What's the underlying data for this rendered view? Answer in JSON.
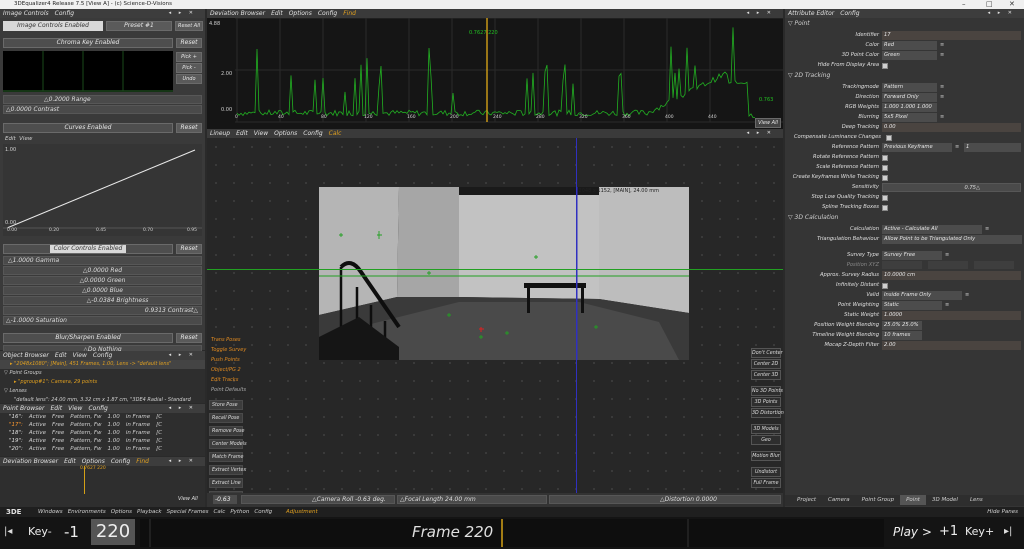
{
  "window": {
    "title": "3DEqualizer4 Release 7.5  [View A] - (c) Science-D-Visions",
    "min": "–",
    "max": "□",
    "close": "✕"
  },
  "image_controls": {
    "title": "Image Controls",
    "config": "Config",
    "enabled_label": "Image Controls Enabled",
    "preset": "Preset #1",
    "reset_all": "Reset All",
    "chroma": {
      "label": "Chroma Key Enabled",
      "reset": "Reset",
      "pick_plus": "Pick +",
      "pick_minus": "Pick -",
      "undo": "Undo",
      "range": "0.2000 Range",
      "contrast": "0.0000 Contrast"
    },
    "curves": {
      "label": "Curves Enabled",
      "reset": "Reset",
      "edit": "Edit",
      "view": "View",
      "y_top": "1.00",
      "y_bottom": "0.00",
      "x_ticks": [
        "0.00",
        "0.20",
        "0.45",
        "0.70",
        "0.95"
      ]
    },
    "color": {
      "label": "Color Controls Enabled",
      "reset": "Reset",
      "gamma": "1.0000 Gamma",
      "red": "0.0000 Red",
      "green": "0.0000 Green",
      "blue": "0.0000 Blue",
      "brightness": "-0.0384 Brightness",
      "contrast": "0.9313 Contrast",
      "saturation": "-1.0000 Saturation"
    },
    "blur": {
      "label": "Blur/Sharpen Enabled",
      "reset": "Reset",
      "value": "Do Nothing"
    }
  },
  "object_browser": {
    "title": "Object Browser",
    "menus": [
      "Edit",
      "View",
      "Config"
    ],
    "camera_line": "\"2048x1080\"; [Main], 451 Frames, 1.00, Lens -> \"default lens\"",
    "point_groups": "Point Groups",
    "pgroup_line": "\"pgroup#1\": Camera, 29 points",
    "lenses": "Lenses",
    "lens_line": "\"default lens\": 24.00 mm, 3.32 cm x 1.87 cm, \"3DE4 Radial - Standard"
  },
  "point_browser": {
    "title": "Point Browser",
    "menus": [
      "Edit",
      "View",
      "Config"
    ],
    "rows": [
      [
        "\"16\":",
        "Active",
        "Free",
        "Pattern, Fw",
        "1.00",
        "in Frame",
        "[C"
      ],
      [
        "\"17\":",
        "Active",
        "Free",
        "Pattern, Fw",
        "1.00",
        "in Frame",
        "[C"
      ],
      [
        "\"18\":",
        "Active",
        "Free",
        "Pattern, Fw",
        "1.00",
        "in Frame",
        "[C"
      ],
      [
        "\"19\":",
        "Active",
        "Free",
        "Pattern, Fw",
        "1.00",
        "in Frame",
        "[C"
      ],
      [
        "\"20\":",
        "Active",
        "Free",
        "Pattern, Fw",
        "1.00",
        "in Frame",
        "[C"
      ]
    ]
  },
  "deviation_small": {
    "title": "Deviation Browser",
    "menus": [
      "Edit",
      "Options",
      "Config"
    ],
    "find": "Find",
    "readout": "0.7627 220",
    "view_all": "View All"
  },
  "deviation_browser": {
    "title": "Deviation Browser",
    "menus": [
      "Edit",
      "Options",
      "Config"
    ],
    "find": "Find",
    "y_labels": [
      "4.88",
      "2.00",
      "0.00"
    ],
    "x_labels": [
      "0",
      "40",
      "80",
      "120",
      "160",
      "200",
      "240",
      "280",
      "320",
      "360",
      "400",
      "440"
    ],
    "marker_readout": "0.7627 220",
    "end_readout": "0.763",
    "view_all": "View All"
  },
  "viewport": {
    "menus": [
      "Lineup",
      "Edit",
      "View",
      "Options",
      "Config"
    ],
    "calc": "Calc",
    "image_info": "2048 x 1152, [MAIN], 24.00 mm",
    "left_orange": [
      "Trans Poses",
      "Toggle Survey",
      "Push Points",
      "Object/PG 2",
      "Edit Tracks"
    ],
    "left_gray": [
      "Point Defaults"
    ],
    "left_buttons": [
      "Store Pose",
      "Recall Pose",
      "Remove Pose",
      "Center Models",
      "Match Frame",
      "Extract Vertex",
      "Extract Line",
      "Extract Polygon"
    ],
    "right_buttons": [
      "Don't Center",
      "Center 2D",
      "Center 3D",
      "No 3D Points",
      "3D Points",
      "3D Distortion",
      "3D Models",
      "Geo",
      "Motion Blur",
      "Undistort",
      "Full Frame"
    ],
    "bottom": {
      "value": "-0.63",
      "roll": "Camera Roll -0.63 deg.",
      "focal": "Focal Length 24.00 mm",
      "distortion": "Distortion 0.0000"
    }
  },
  "attribute_editor": {
    "title": "Attribute Editor",
    "config": "Config",
    "point_section": "Point",
    "identifier_label": "Identifier",
    "identifier": "17",
    "color_label": "Color",
    "color": "Red",
    "color3d_label": "3D Point Color",
    "color3d": "Green",
    "hide_label": "Hide From Display Area",
    "tracking_section": "2D Tracking",
    "trackingmode_label": "Trackingmode",
    "trackingmode": "Pattern",
    "direction_label": "Direction",
    "direction": "Forward Only",
    "rgb_label": "RGB Weights",
    "rgb": "1.000 1.000 1.000",
    "blurring_label": "Blurring",
    "blurring": "5x5 Pixel",
    "deep_label": "Deep Tracking",
    "deep": "0.00",
    "lum_label": "Compensate Luminance Changes",
    "refpat_label": "Reference Pattern",
    "refpat": "Previous Keyframe",
    "refpat_num": "1",
    "rotate_label": "Rotate Reference Pattern",
    "scale_label": "Scale Reference Pattern",
    "keyframes_label": "Create Keyframes While Tracking",
    "sensitivity_label": "Sensitivity",
    "sensitivity": "0.75",
    "stoplow_label": "Stop Low Quality Tracking",
    "spline_label": "Spline Tracking Boxes",
    "calc_section": "3D Calculation",
    "calculation_label": "Calculation",
    "calculation": "Active - Calculate All",
    "triang_label": "Triangulation Behaviour",
    "triang": "Allow Point to be Triangulated Only",
    "survey_label": "Survey Type",
    "survey": "Survey Free",
    "posxyz_label": "Position XYZ",
    "approx_label": "Approx. Survey Radius",
    "approx": "10.0000 cm",
    "infinitely_label": "Infinitely Distant",
    "valid_label": "Valid",
    "valid": "Inside Frame Only",
    "pointweight_label": "Point Weighting",
    "pointweight": "Static",
    "staticweight_label": "Static Weight",
    "staticweight": "1.0000",
    "posblend_label": "Position Weight Blending",
    "posblend": "25.0%  25.0%",
    "timeline_label": "Timeline Weight Blending",
    "timeline": "10 frames",
    "mocap_label": "Mocap Z-Depth Filter",
    "mocap": "2.00",
    "tabs": [
      "Project",
      "Camera",
      "Point Group",
      "Point",
      "3D Model",
      "Lens"
    ]
  },
  "menubar": {
    "logo": "3DE",
    "items": [
      "Windows",
      "Environments",
      "Options",
      "Playback",
      "Special Frames",
      "Calc",
      "Python",
      "Config"
    ],
    "adjustment": "Adjustment",
    "hide_panes": "Hide Panes"
  },
  "timeline": {
    "key_minus": "Key-",
    "minus1": "-1",
    "frame_num": "220",
    "frame_label": "Frame 220",
    "play": "Play >",
    "plus1": "+1",
    "key_plus": "Key+"
  },
  "colors": {
    "accent_orange": "#e0a020",
    "plot_green": "#22b022",
    "marker": "#d4a017"
  }
}
